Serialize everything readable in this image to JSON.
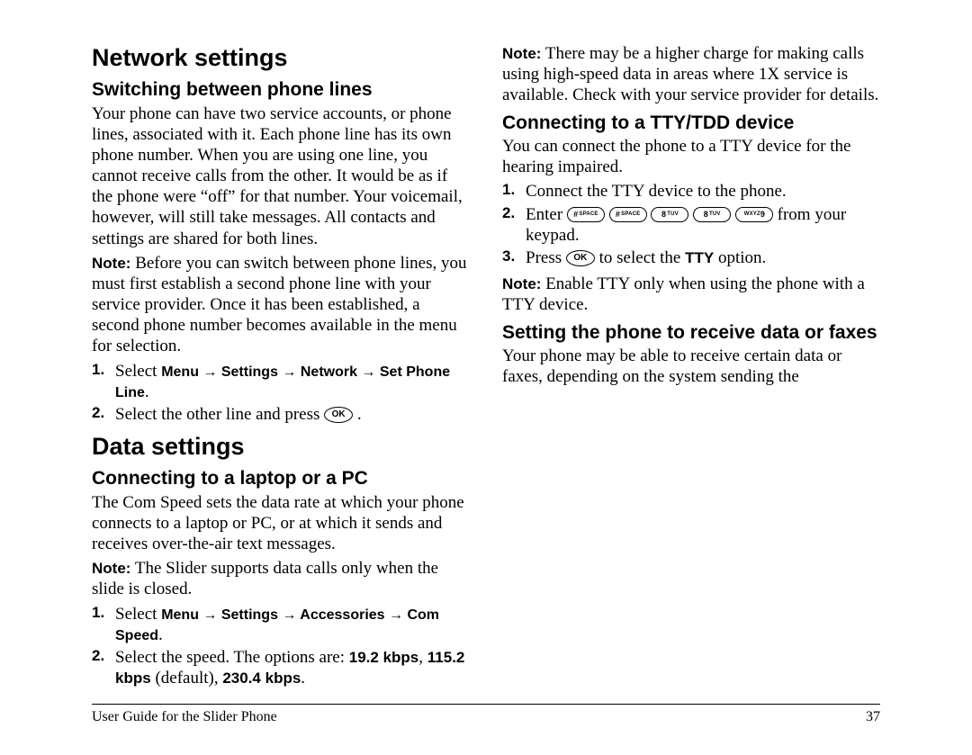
{
  "left": {
    "h1_network": "Network settings",
    "h2_switching": "Switching between phone lines",
    "p_switching": "Your phone can have two service accounts, or phone lines, associated with it. Each phone line has its own phone number. When you are using one line, you cannot receive calls from the other. It would be as if the phone were “off” for that number. Your voicemail, however, will still take messages. All contacts and settings are shared for both lines.",
    "note_switching_lead": "Note:",
    "note_switching": "Before you can switch between phone lines, you must first establish a second phone line with your service provider. Once it has been established, a second phone number becomes available in the menu for selection.",
    "steps_switch": {
      "1": {
        "pre": "Select ",
        "menu_path": "Menu → Settings → Network → Set Phone Line",
        "post": "."
      },
      "2": {
        "pre": "Select the other line and press ",
        "post": "."
      }
    },
    "h1_data": "Data settings",
    "h2_laptop": "Connecting to a laptop or a PC",
    "p_laptop": "The Com Speed sets the data rate at which your phone connects to a laptop or PC, or at which it sends and receives over-the-air text messages."
  },
  "right": {
    "note_slider_lead": "Note:",
    "note_slider": "The Slider supports data calls only when the slide is closed.",
    "steps_speed": {
      "1": {
        "pre": "Select ",
        "menu_path": "Menu → Settings → Accessories → Com Speed",
        "post": "."
      },
      "2": {
        "pre": "Select the speed. The options are: ",
        "o1": "19.2 kbps",
        "mid1": ", ",
        "o2": "115.2 kbps",
        "mid2": " (default), ",
        "o3": "230.4 kbps",
        "post": "."
      }
    },
    "note_charge_lead": "Note:",
    "note_charge": "There may be a higher charge for making calls using high-speed data in areas where 1X service is available. Check with your service provider for details.",
    "h2_tty": "Connecting to a TTY/TDD device",
    "p_tty": "You can connect the phone to a TTY device for the hearing impaired.",
    "steps_tty": {
      "1": {
        "text": "Connect the TTY device to the phone."
      },
      "2": {
        "pre": "Enter ",
        "post": " from your keypad."
      },
      "3": {
        "pre": "Press ",
        "mid": " to select the ",
        "opt": "TTY",
        "post": " option."
      }
    },
    "note_tty_lead": "Note:",
    "note_tty": "Enable TTY only when using the phone with a TTY device.",
    "h2_fax": "Setting the phone to receive data or faxes",
    "p_fax": "Your phone may be able to receive certain data or faxes, depending on the system sending the"
  },
  "keypad": {
    "hash_main": "#",
    "hash_sub": "SPACE",
    "eight_main": "8",
    "eight_sub": "TUV",
    "nine_main": "WXYZ",
    "nine_sub": "9",
    "ok": "OK"
  },
  "footer": {
    "left": "User Guide for the Slider Phone",
    "right": "37"
  }
}
